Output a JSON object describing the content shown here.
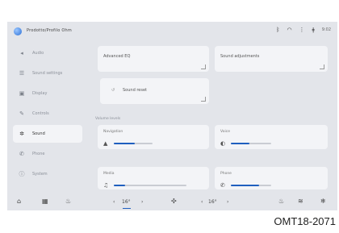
{
  "header": {
    "profile_name": "Prodotto/Profilo Ohm",
    "status_time": "9:02"
  },
  "sidebar": {
    "items": [
      {
        "label": "Audio",
        "icon": "speaker-icon"
      },
      {
        "label": "Sound settings",
        "icon": "sliders-icon"
      },
      {
        "label": "Display",
        "icon": "display-icon"
      },
      {
        "label": "Controls",
        "icon": "wrench-icon"
      },
      {
        "label": "Sound",
        "icon": "gear-icon",
        "active": true
      },
      {
        "label": "Phone",
        "icon": "phone-icon"
      },
      {
        "label": "System",
        "icon": "info-icon"
      }
    ]
  },
  "main": {
    "card_advanced": "Advanced EQ",
    "card_sound_adjust": "Sound adjustments",
    "card_reset": "Sound reset",
    "section_volume": "Volume levels",
    "sliders": [
      {
        "label": "Navigation",
        "level": 0.55
      },
      {
        "label": "Voice",
        "level": 0.45
      },
      {
        "label": "Media",
        "level": 0.15
      },
      {
        "label": "Phone",
        "level": 0.7
      }
    ]
  },
  "bottom": {
    "temp_left": "16°",
    "temp_right": "16°"
  },
  "caption": "OMT18-2071"
}
